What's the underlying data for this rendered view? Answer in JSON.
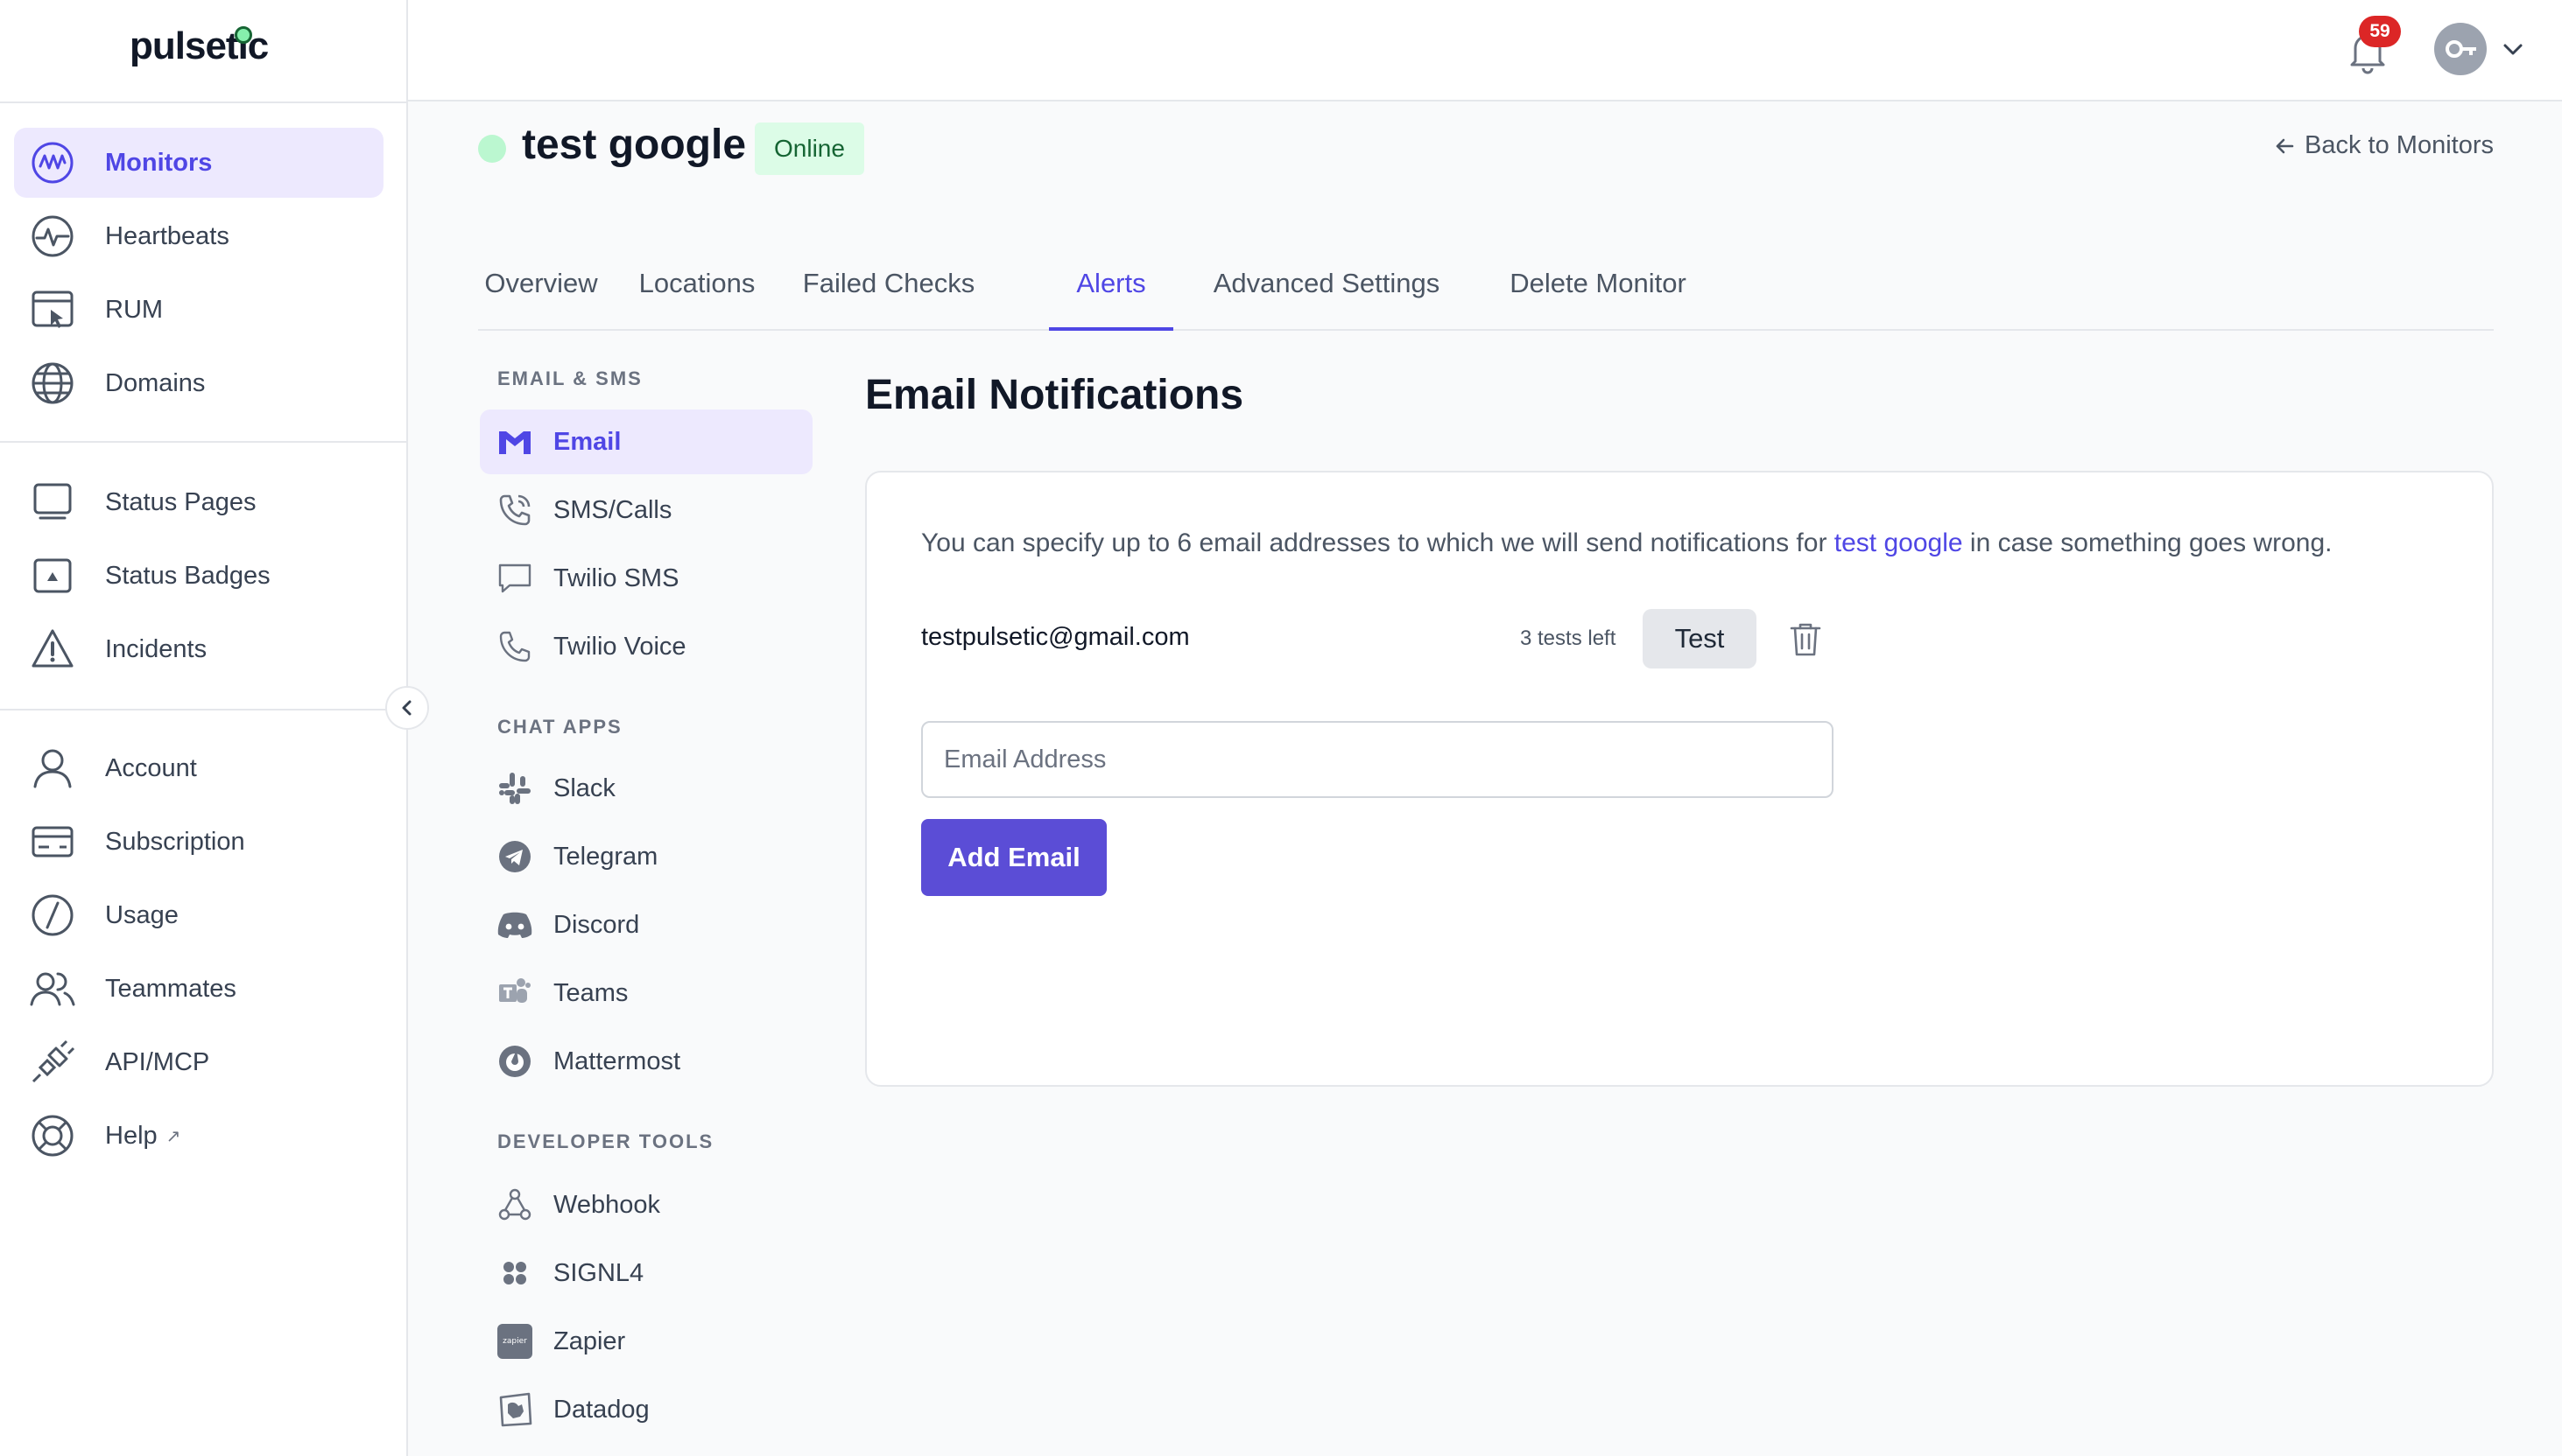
{
  "app": {
    "logo": "pulsetic"
  },
  "sidebar": {
    "items": [
      {
        "label": "Monitors"
      },
      {
        "label": "Heartbeats"
      },
      {
        "label": "RUM"
      },
      {
        "label": "Domains"
      },
      {
        "label": "Status Pages"
      },
      {
        "label": "Status Badges"
      },
      {
        "label": "Incidents"
      },
      {
        "label": "Account"
      },
      {
        "label": "Subscription"
      },
      {
        "label": "Usage"
      },
      {
        "label": "Teammates"
      },
      {
        "label": "API/MCP"
      },
      {
        "label": "Help"
      }
    ],
    "help_ext_glyph": "↗"
  },
  "topbar": {
    "notification_count": "59"
  },
  "monitor": {
    "name": "test google",
    "status": "Online",
    "back_link": "Back to Monitors"
  },
  "tabs": [
    {
      "label": "Overview"
    },
    {
      "label": "Locations"
    },
    {
      "label": "Failed Checks"
    },
    {
      "label": "Alerts"
    },
    {
      "label": "Advanced Settings"
    },
    {
      "label": "Delete Monitor"
    }
  ],
  "alerts_nav": {
    "sections": [
      {
        "title": "EMAIL & SMS",
        "items": [
          "Email",
          "SMS/Calls",
          "Twilio SMS",
          "Twilio Voice"
        ]
      },
      {
        "title": "CHAT APPS",
        "items": [
          "Slack",
          "Telegram",
          "Discord",
          "Teams",
          "Mattermost"
        ]
      },
      {
        "title": "DEVELOPER TOOLS",
        "items": [
          "Webhook",
          "SIGNL4",
          "Zapier",
          "Datadog"
        ]
      }
    ],
    "zapier_logo_text": "zapier"
  },
  "email": {
    "title": "Email Notifications",
    "desc_before": "You can specify up to 6 email addresses to which we will send notifications for ",
    "desc_link": "test google",
    "desc_after": " in case something goes wrong.",
    "address": "testpulsetic@gmail.com",
    "tests_left": "3 tests left",
    "test_button": "Test",
    "input_placeholder": "Email Address",
    "add_button": "Add Email"
  },
  "colors": {
    "accent": "#4f46e5",
    "online_bg": "#dcfce7",
    "online_text": "#166534",
    "badge": "#dc2626"
  }
}
